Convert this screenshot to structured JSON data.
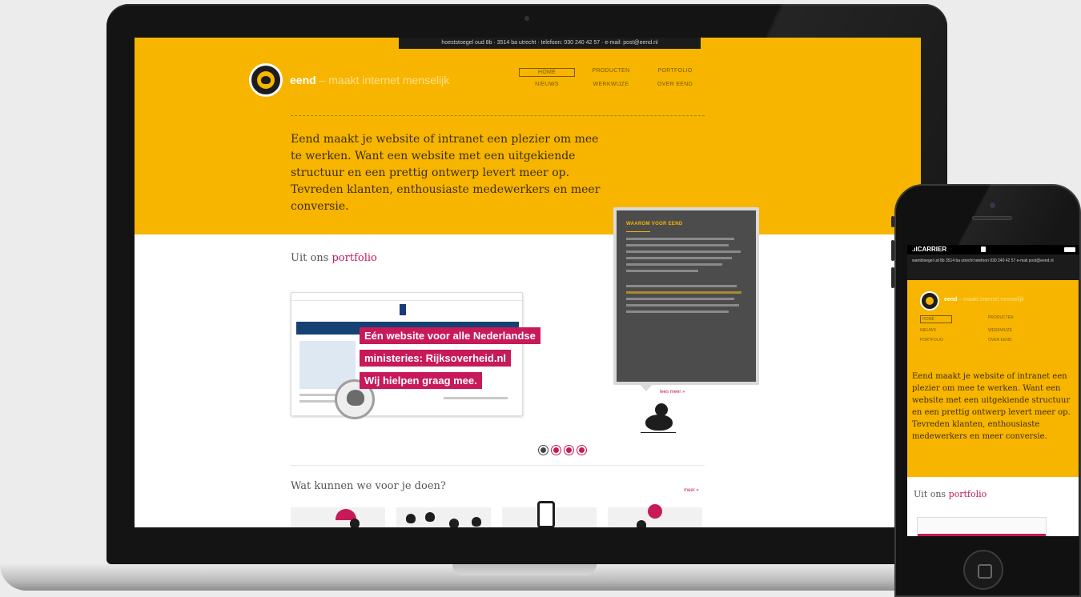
{
  "site": {
    "topbar": "hoeststoegel oud 8b  ·  3514 ba utrecht  ·  telefoon: 030 240 42 57  ·  e-mail: post@eend.nl",
    "brand": "eend",
    "tagline": " – maakt internet menselijk",
    "nav": [
      "HOME",
      "PRODUCTEN",
      "PORTFOLIO",
      "NIEUWS",
      "WERKWIJZE",
      "OVER EEND"
    ],
    "intro": "Eend maakt je website of intranet een plezier om mee te werken. Want een website met een uitgekiende structuur en een prettig ontwerp levert meer op. Tevreden klanten, enthousiaste medewerkers en meer conversie.",
    "portfolio_title_prefix": "Uit ons ",
    "portfolio_title_link": "portfolio",
    "callout": [
      "Eén website voor alle Nederlandse",
      "ministeries: Rijksoverheid.nl",
      "Wij hielpen graag mee."
    ],
    "tooltip_title": "WAAROM VOOR EEND",
    "read_more": "lees meer »",
    "services_title": "Wat kunnen we voor je doen?",
    "more_link": "meer »",
    "pager_count": 4,
    "pager_current": 1
  },
  "phone": {
    "carrier": "CARRIER",
    "info": "wambtsegel ud 8b  3514 ba utrecht  telefoon 030 240 42 57  e-mail post@eend.nl",
    "brand": "eend",
    "tagline": " – maakt internet menselijk",
    "nav": [
      "HOME",
      "PRODUCTEN",
      "NIEUWS",
      "WERKWIJZE",
      "PORTFOLIO",
      "OVER EEND"
    ],
    "intro": "Eend maakt je website of intranet een plezier om mee te werken. Want een website met een uitgekiende structuur en een prettig ontwerp levert meer op. Tevreden klanten, enthousiaste medewerkers en meer conversie.",
    "portfolio_title_prefix": "Uit ons ",
    "portfolio_title_link": "portfolio"
  },
  "colors": {
    "yellow": "#f7b500",
    "pink": "#c8195a",
    "dark": "#1d1d1d"
  }
}
